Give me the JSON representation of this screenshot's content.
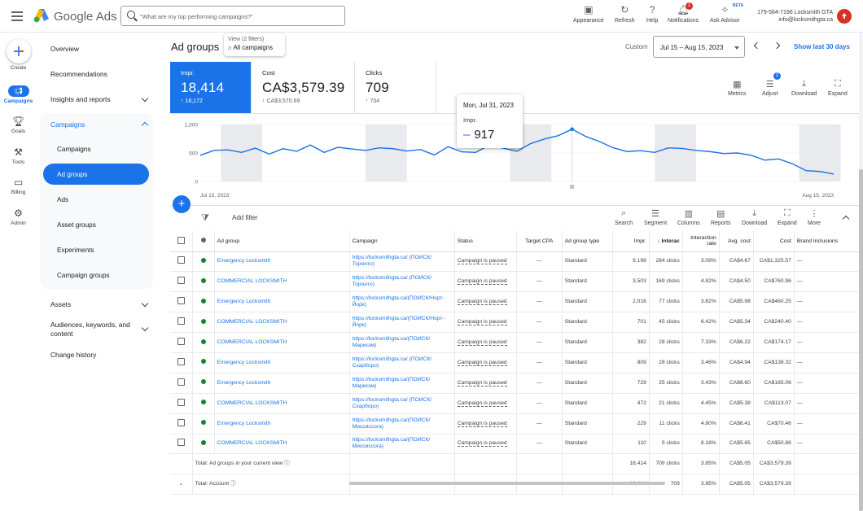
{
  "header": {
    "brand": "Google Ads",
    "search_placeholder": "\"What are my top performing campaigns?\"",
    "tools": [
      {
        "label": "Appearance",
        "icon": "appearance-icon"
      },
      {
        "label": "Refresh",
        "icon": "refresh-icon"
      },
      {
        "label": "Help",
        "icon": "help-icon"
      },
      {
        "label": "Notifications",
        "icon": "bell-icon",
        "badge": "1"
      },
      {
        "label": "Ask Advisor",
        "icon": "advisor-icon",
        "tag": "BETA"
      }
    ],
    "account_line1": "179-564-7196 Locksmith GTA",
    "account_line2": "info@locksmithgta.ca"
  },
  "nav": {
    "create": "Create",
    "campaigns": "Campaigns",
    "goals": "Goals",
    "tools": "Tools",
    "billing": "Billing",
    "admin": "Admin"
  },
  "sidebar": {
    "overview": "Overview",
    "recommendations": "Recommendations",
    "insights": "Insights and reports",
    "campaigns_group": "Campaigns",
    "sub": [
      "Campaigns",
      "Ad groups",
      "Ads",
      "Asset groups",
      "Experiments",
      "Campaign groups"
    ],
    "assets": "Assets",
    "audiences": "Audiences, keywords, and content",
    "change_history": "Change history"
  },
  "page": {
    "title": "Ad groups",
    "view_filters": "View (2 filters)",
    "view_all": "All campaigns",
    "custom": "Custom",
    "date_range": "Jul 15 – Aug 15, 2023",
    "show_last": "Show last 30 days"
  },
  "kpis": [
    {
      "label": "Impr.",
      "value": "18,414",
      "delta": "18,172"
    },
    {
      "label": "Cost",
      "value": "CA$3,579.39",
      "delta": "CA$3,570.69"
    },
    {
      "label": "Clicks",
      "value": "709",
      "delta": "704"
    }
  ],
  "chart_tools": [
    {
      "label": "Metrics",
      "icon": "metrics-icon"
    },
    {
      "label": "Adjust",
      "icon": "adjust-icon",
      "badge": "2"
    },
    {
      "label": "Download",
      "icon": "download-icon"
    },
    {
      "label": "Expand",
      "icon": "expand-icon"
    }
  ],
  "chart_data": {
    "type": "line",
    "series": [
      {
        "name": "Impr.",
        "color": "#1a73e8",
        "values": [
          460,
          545,
          555,
          510,
          585,
          480,
          575,
          530,
          640,
          510,
          600,
          570,
          545,
          590,
          575,
          535,
          560,
          465,
          610,
          520,
          510,
          640,
          585,
          530,
          665,
          745,
          805,
          917,
          790,
          700,
          590,
          525,
          540,
          510,
          590,
          580,
          545,
          525,
          490,
          500,
          460,
          375,
          395,
          310,
          190,
          175,
          130
        ]
      }
    ],
    "yticks": [
      "1,000",
      "500",
      "0"
    ],
    "ylim": [
      0,
      1000
    ],
    "x_start": "Jul 15, 2023",
    "x_end": "Aug 15, 2023",
    "tooltip": {
      "date": "Mon, Jul 31, 2023",
      "metric": "Impr.",
      "value": "917"
    }
  },
  "table_tools": [
    {
      "label": "Search",
      "icon": "search-icon"
    },
    {
      "label": "Segment",
      "icon": "segment-icon"
    },
    {
      "label": "Columns",
      "icon": "columns-icon"
    },
    {
      "label": "Reports",
      "icon": "reports-icon"
    },
    {
      "label": "Download",
      "icon": "download-icon"
    },
    {
      "label": "Expand",
      "icon": "expand-icon"
    },
    {
      "label": "More",
      "icon": "more-icon"
    }
  ],
  "add_filter": "Add filter",
  "table": {
    "headers": [
      "Ad group",
      "Campaign",
      "Status",
      "Target CPA",
      "Ad group type",
      "Impr.",
      "Interac",
      "Interaction rate",
      "Avg. cost",
      "Cost",
      "Brand Inclusions"
    ],
    "rows": [
      [
        "Emergency Locksmith",
        "https://locksmithgta.ca/ (ПОИСК/ Торонто)",
        "Campaign is paused",
        "—",
        "Standard",
        "9,198",
        "284 clicks",
        "3.09%",
        "CA$4.67",
        "CA$1,325.57",
        "—"
      ],
      [
        "COMMERCIAL LOCKSMITH",
        "https://locksmithgta.ca/ (ПОИСК/ Торонто)",
        "Campaign is paused",
        "—",
        "Standard",
        "3,503",
        "169 clicks",
        "4.82%",
        "CA$4.50",
        "CA$760.96",
        "—"
      ],
      [
        "Emergency Locksmith",
        "https://locksmithgta.ca/(ПОИСК/Норт-Йорк)",
        "Campaign is paused",
        "—",
        "Standard",
        "2,016",
        "77 clicks",
        "3.82%",
        "CA$5.98",
        "CA$460.25",
        "—"
      ],
      [
        "COMMERCIAL LOCKSMITH",
        "https://locksmithgta.ca/(ПОИСК/Норт-Йорк)",
        "Campaign is paused",
        "—",
        "Standard",
        "701",
        "45 clicks",
        "6.42%",
        "CA$5.34",
        "CA$240.40",
        "—"
      ],
      [
        "COMMERCIAL LOCKSMITH",
        "https://locksmithgta.ca/(ПОИСК/ Маркхэм)",
        "Campaign is paused",
        "—",
        "Standard",
        "382",
        "28 clicks",
        "7.33%",
        "CA$6.22",
        "CA$174.17",
        "—"
      ],
      [
        "Emergency Locksmith",
        "https://locksmithgta.ca/ (ПОИСК/ Скарборо)",
        "Campaign is paused",
        "—",
        "Standard",
        "809",
        "28 clicks",
        "3.46%",
        "CA$4.94",
        "CA$138.32",
        "—"
      ],
      [
        "Emergency Locksmith",
        "https://locksmithgta.ca/(ПОИСК/ Маркхэм)",
        "Campaign is paused",
        "—",
        "Standard",
        "729",
        "25 clicks",
        "3.43%",
        "CA$6.60",
        "CA$165.06",
        "—"
      ],
      [
        "COMMERCIAL LOCKSMITH",
        "https://locksmithgta.ca/ (ПОИСК/ Скарборо)",
        "Campaign is paused",
        "—",
        "Standard",
        "472",
        "21 clicks",
        "4.45%",
        "CA$5.38",
        "CA$113.07",
        "—"
      ],
      [
        "Emergency Locksmith",
        "https://locksmithgta.ca/(ПОИСК/ Миссиссога)",
        "Campaign is paused",
        "—",
        "Standard",
        "229",
        "11 clicks",
        "4.80%",
        "CA$6.41",
        "CA$70.46",
        "—"
      ],
      [
        "COMMERCIAL LOCKSMITH",
        "https://locksmithgta.ca/(ПОИСК/ Миссиссога)",
        "Campaign is paused",
        "—",
        "Standard",
        "110",
        "9 clicks",
        "8.18%",
        "CA$5.65",
        "CA$50.88",
        "—"
      ]
    ],
    "total_view": {
      "label": "Total: Ad groups in your current view",
      "impr": "18,414",
      "clicks": "709 clicks",
      "rate": "3.85%",
      "avg": "CA$5.05",
      "cost": "CA$3,579.39"
    },
    "total_account": {
      "label": "Total: Account",
      "impr": "18,414",
      "clicks": "709",
      "rate": "3.85%",
      "avg": "CA$5.05",
      "cost": "CA$3,579.39"
    }
  }
}
